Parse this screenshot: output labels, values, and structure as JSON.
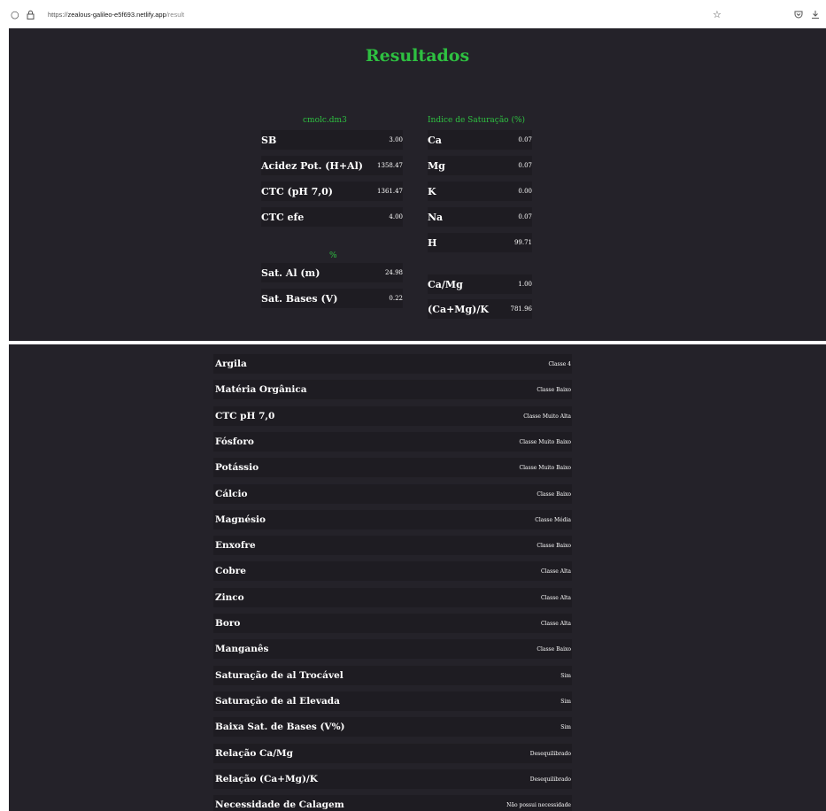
{
  "browser": {
    "url_prefix": "https://",
    "url_host": "zealous-galileo-e5f693.netlify.app",
    "url_path": "/result"
  },
  "page": {
    "title": "Resultados"
  },
  "cmolc": {
    "header": "cmolc.dm3",
    "rows": [
      {
        "label": "SB",
        "value": "3.00"
      },
      {
        "label": "Acidez Pot. (H+Al)",
        "value": "1358.47"
      },
      {
        "label": "CTC (pH 7,0)",
        "value": "1361.47"
      },
      {
        "label": "CTC efe",
        "value": "4.00"
      }
    ]
  },
  "percent": {
    "header": "%",
    "rows": [
      {
        "label": "Sat. Al (m)",
        "value": "24.98"
      },
      {
        "label": "Sat. Bases (V)",
        "value": "0.22"
      }
    ]
  },
  "saturacao": {
    "header": "Indice de Saturação (%)",
    "rows": [
      {
        "label": "Ca",
        "value": "0.07"
      },
      {
        "label": "Mg",
        "value": "0.07"
      },
      {
        "label": "K",
        "value": "0.00"
      },
      {
        "label": "Na",
        "value": "0.07"
      },
      {
        "label": "H",
        "value": "99.71"
      }
    ]
  },
  "relacoes": {
    "rows": [
      {
        "label": "Ca/Mg",
        "value": "1.00"
      },
      {
        "label": "(Ca+Mg)/K",
        "value": "781.96"
      }
    ]
  },
  "classes": [
    {
      "label": "Argila",
      "value": "Classe 4"
    },
    {
      "label": "Matéria Orgânica",
      "value": "Classe Baixo"
    },
    {
      "label": "CTC pH 7,0",
      "value": "Classe Muito Alta"
    },
    {
      "label": "Fósforo",
      "value": "Classe Muito Baixo"
    },
    {
      "label": "Potássio",
      "value": "Classe Muito Baixo"
    },
    {
      "label": "Cálcio",
      "value": "Classe Baixo"
    },
    {
      "label": "Magnésio",
      "value": "Classe Média"
    },
    {
      "label": "Enxofre",
      "value": "Classe Baixo"
    },
    {
      "label": "Cobre",
      "value": "Classe Alta"
    },
    {
      "label": "Zinco",
      "value": "Classe Alta"
    },
    {
      "label": "Boro",
      "value": "Classe Alta"
    },
    {
      "label": "Manganês",
      "value": "Classe Baixo"
    },
    {
      "label": "Saturação de al Trocável",
      "value": "Sim"
    },
    {
      "label": "Saturação de al Elevada",
      "value": "Sim"
    },
    {
      "label": "Baixa Sat. de Bases (V%)",
      "value": "Sim"
    },
    {
      "label": "Relação Ca/Mg",
      "value": "Desequilibrado"
    },
    {
      "label": "Relação (Ca+Mg)/K",
      "value": "Desequilibrado"
    },
    {
      "label": "Necessidade de Calagem",
      "value": "Não possui necessidade"
    }
  ]
}
